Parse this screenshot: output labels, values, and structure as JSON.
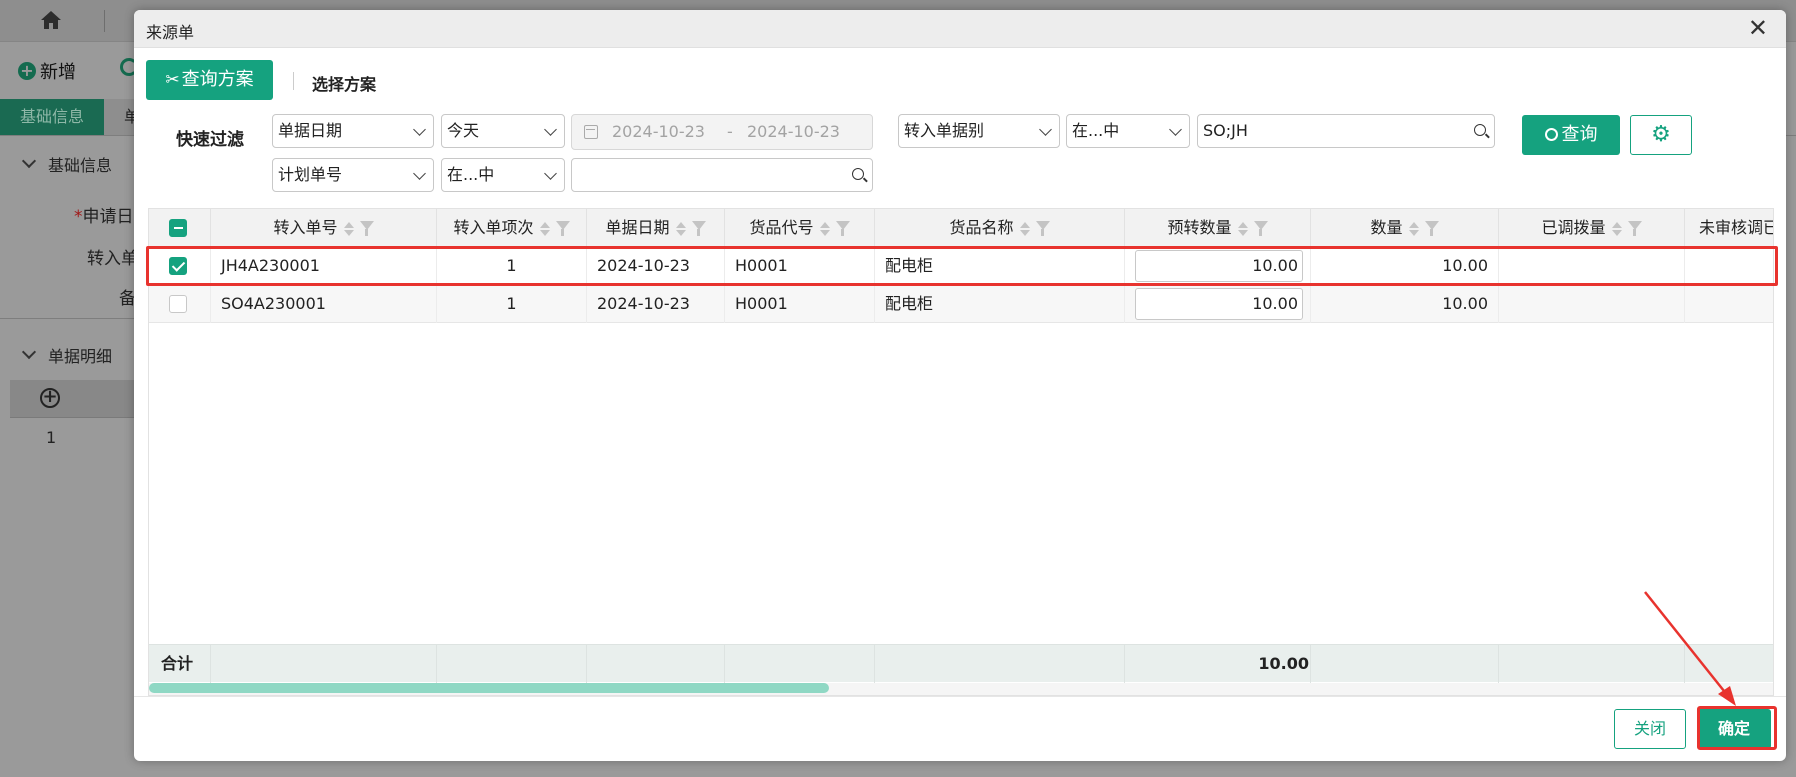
{
  "background": {
    "add_label": "新增",
    "tab_basic": "基础信息",
    "tab_second": "单",
    "section_basic": "基础信息",
    "field_apply_date": "申请日",
    "field_transfer": "转入单",
    "field_remark": "备",
    "section_detail": "单据明细",
    "row_index": "1"
  },
  "modal": {
    "title": "来源单",
    "close_icon": "close-icon",
    "query_plan_label": "查询方案",
    "select_plan_label": "选择方案",
    "quick_filter_label": "快速过滤",
    "filter1_field": "单据日期",
    "filter1_op": "今天",
    "date_start": "2024-10-23",
    "date_sep": "-",
    "date_end": "2024-10-23",
    "filter2_field": "转入单据别",
    "filter2_op": "在...中",
    "filter2_value": "SO;JH",
    "filter3_field": "计划单号",
    "filter3_op": "在...中",
    "filter3_value": "",
    "query_label": "查询",
    "settings_icon": "gear-icon",
    "close_button": "关闭",
    "confirm_button": "确定"
  },
  "table": {
    "headers": [
      "转入单号",
      "转入单项次",
      "单据日期",
      "货品代号",
      "货品名称",
      "预转数量",
      "数量",
      "已调拨量",
      "未审核调已"
    ],
    "rows": [
      {
        "checked": true,
        "order_no": "JH4A230001",
        "item_seq": "1",
        "doc_date": "2024-10-23",
        "product_code": "H0001",
        "product_name": "配电柜",
        "pre_qty": "10.00",
        "qty": "10.00",
        "allocated": "",
        "unaudited": ""
      },
      {
        "checked": false,
        "order_no": "SO4A230001",
        "item_seq": "1",
        "doc_date": "2024-10-23",
        "product_code": "H0001",
        "product_name": "配电柜",
        "pre_qty": "10.00",
        "qty": "10.00",
        "allocated": "",
        "unaudited": ""
      }
    ],
    "footer_label": "合计",
    "footer_total": "10.00"
  },
  "colors": {
    "accent": "#15a27f",
    "highlight": "#e8332e"
  }
}
